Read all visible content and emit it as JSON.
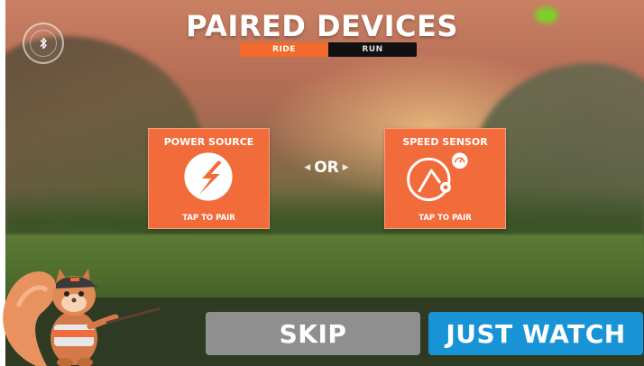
{
  "header": {
    "title": "PAIRED DEVICES",
    "tabs": [
      {
        "label": "RIDE",
        "active": true
      },
      {
        "label": "RUN",
        "active": false
      }
    ]
  },
  "bluetooth": {
    "icon": "bluetooth-icon"
  },
  "cards": {
    "power": {
      "title": "POWER SOURCE",
      "action": "TAP TO PAIR",
      "icon": "power-bolt-icon"
    },
    "speed": {
      "title": "SPEED SENSOR",
      "action": "TAP TO PAIR",
      "icon": "speed-wheel-icon"
    }
  },
  "separator": {
    "label": "OR"
  },
  "buttons": {
    "skip": "SKIP",
    "watch": "JUST WATCH"
  },
  "colors": {
    "accent_orange": "#f26b3a",
    "tab_active": "#f26b2c",
    "skip_gray": "#8f8f8f",
    "watch_blue": "#1793d6"
  },
  "mascot": {
    "icon": "squirrel-mascot-icon"
  }
}
